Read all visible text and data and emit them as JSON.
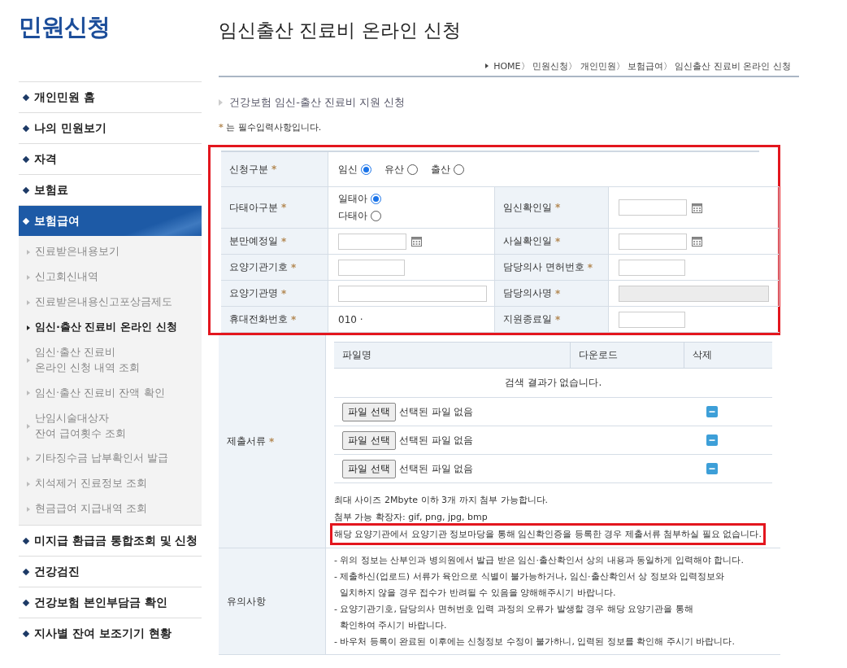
{
  "sidebar": {
    "title": "민원신청",
    "items": [
      {
        "label": "개인민원 홈",
        "selected": false
      },
      {
        "label": "나의 민원보기",
        "selected": false
      },
      {
        "label": "자격",
        "selected": false
      },
      {
        "label": "보험료",
        "selected": false
      },
      {
        "label": "보험급여",
        "selected": true,
        "children": [
          {
            "label": "진료받은내용보기",
            "selected": false
          },
          {
            "label": "신고회신내역",
            "selected": false
          },
          {
            "label": "진료받은내용신고포상금제도",
            "selected": false
          },
          {
            "label": "임신·출산 진료비 온라인 신청",
            "selected": true
          },
          {
            "label": "임신·출산 진료비\n온라인 신청 내역 조회",
            "selected": false
          },
          {
            "label": "임신·출산 진료비 잔액 확인",
            "selected": false
          },
          {
            "label": "난임시술대상자\n잔여 급여횟수 조회",
            "selected": false
          },
          {
            "label": "기타징수금 납부확인서 발급",
            "selected": false
          },
          {
            "label": "치석제거 진료정보 조회",
            "selected": false
          },
          {
            "label": "현금급여 지급내역 조회",
            "selected": false
          }
        ]
      },
      {
        "label": "미지급 환급금 통합조회 및 신청",
        "selected": false
      },
      {
        "label": "건강검진",
        "selected": false
      },
      {
        "label": "건강보험 본인부담금 확인",
        "selected": false
      },
      {
        "label": "지사별 잔여 보조기기 현황",
        "selected": false
      }
    ]
  },
  "page": {
    "title": "임신출산 진료비 온라인 신청",
    "breadcrumb": "HOME〉 민원신청〉 개인민원〉 보험급여〉 임신출산 진료비 온라인 신청",
    "section_title": "건강보험 임신-출산 진료비 지원 신청",
    "required_note": "는 필수입력사항입니다.",
    "required_mark": "*"
  },
  "form": {
    "highlighted": true,
    "rows": [
      {
        "fields": [
          {
            "label": "신청구분",
            "required": true,
            "kind": "radio-inline",
            "options": [
              {
                "label": "임신",
                "selected": true
              },
              {
                "label": "유산",
                "selected": false
              },
              {
                "label": "출산",
                "selected": false
              }
            ]
          }
        ]
      },
      {
        "fields": [
          {
            "label": "다태아구분",
            "required": true,
            "kind": "radio-stack",
            "options": [
              {
                "label": "일태아",
                "selected": true
              },
              {
                "label": "다태아",
                "selected": false
              }
            ]
          },
          {
            "label": "임신확인일",
            "required": true,
            "kind": "date"
          }
        ]
      },
      {
        "fields": [
          {
            "label": "분만예정일",
            "required": true,
            "kind": "date"
          },
          {
            "label": "사실확인일",
            "required": true,
            "kind": "date"
          }
        ]
      },
      {
        "fields": [
          {
            "label": "요양기관기호",
            "required": true,
            "kind": "text"
          },
          {
            "label": "담당의사 면허번호",
            "required": true,
            "kind": "text"
          }
        ]
      },
      {
        "fields": [
          {
            "label": "요양기관명",
            "required": true,
            "kind": "longtext",
            "disabled": false
          },
          {
            "label": "담당의사명",
            "required": true,
            "kind": "longtext",
            "disabled": true
          }
        ]
      },
      {
        "fields": [
          {
            "label": "휴대전화번호",
            "required": true,
            "kind": "value",
            "value": "010 ·"
          },
          {
            "label": "지원종료일",
            "required": true,
            "kind": "text"
          }
        ]
      }
    ]
  },
  "documents": {
    "label": "제출서류",
    "required": true,
    "columns": [
      "파일명",
      "다운로드",
      "삭제"
    ],
    "empty_message": "검색 결과가 없습니다.",
    "files": [
      {
        "button": "파일 선택",
        "status": "선택된 파일 없음"
      },
      {
        "button": "파일 선택",
        "status": "선택된 파일 없음"
      },
      {
        "button": "파일 선택",
        "status": "선택된 파일 없음"
      }
    ],
    "notes": [
      {
        "text": "최대 사이즈 2Mbyte 이하 3개 까지 첨부 가능합니다.",
        "highlighted": false
      },
      {
        "text": "첨부 가능 확장자: gif, png, jpg, bmp",
        "highlighted": false
      },
      {
        "text": "해당 요양기관에서 요양기관 정보마당을 통해 임신확인증을 등록한 경우 제출서류 첨부하실 필요 없습니다.",
        "highlighted": true
      }
    ]
  },
  "cautions": {
    "label": "유의사항",
    "lines": [
      "- 위의 정보는 산부인과 병의원에서 발급 받은 임신·출산확인서 상의 내용과 동일하게 입력해야 합니다.",
      "- 제출하신(업로드) 서류가 육안으로 식별이 불가능하거나, 임신·출산확인서 상 정보와 입력정보와\n  일치하지 않을 경우 접수가 반려될 수 있음을 양해해주시기 바랍니다.",
      "- 요양기관기호, 담당의사 면허번호 입력 과정의 오류가 발생할 경우 해당 요양기관을 통해\n  확인하여 주시기 바랍니다.",
      "- 바우처 등록이 완료된 이후에는 신청정보 수정이 불가하니, 입력된 정보를 확인해 주시기 바랍니다."
    ]
  }
}
